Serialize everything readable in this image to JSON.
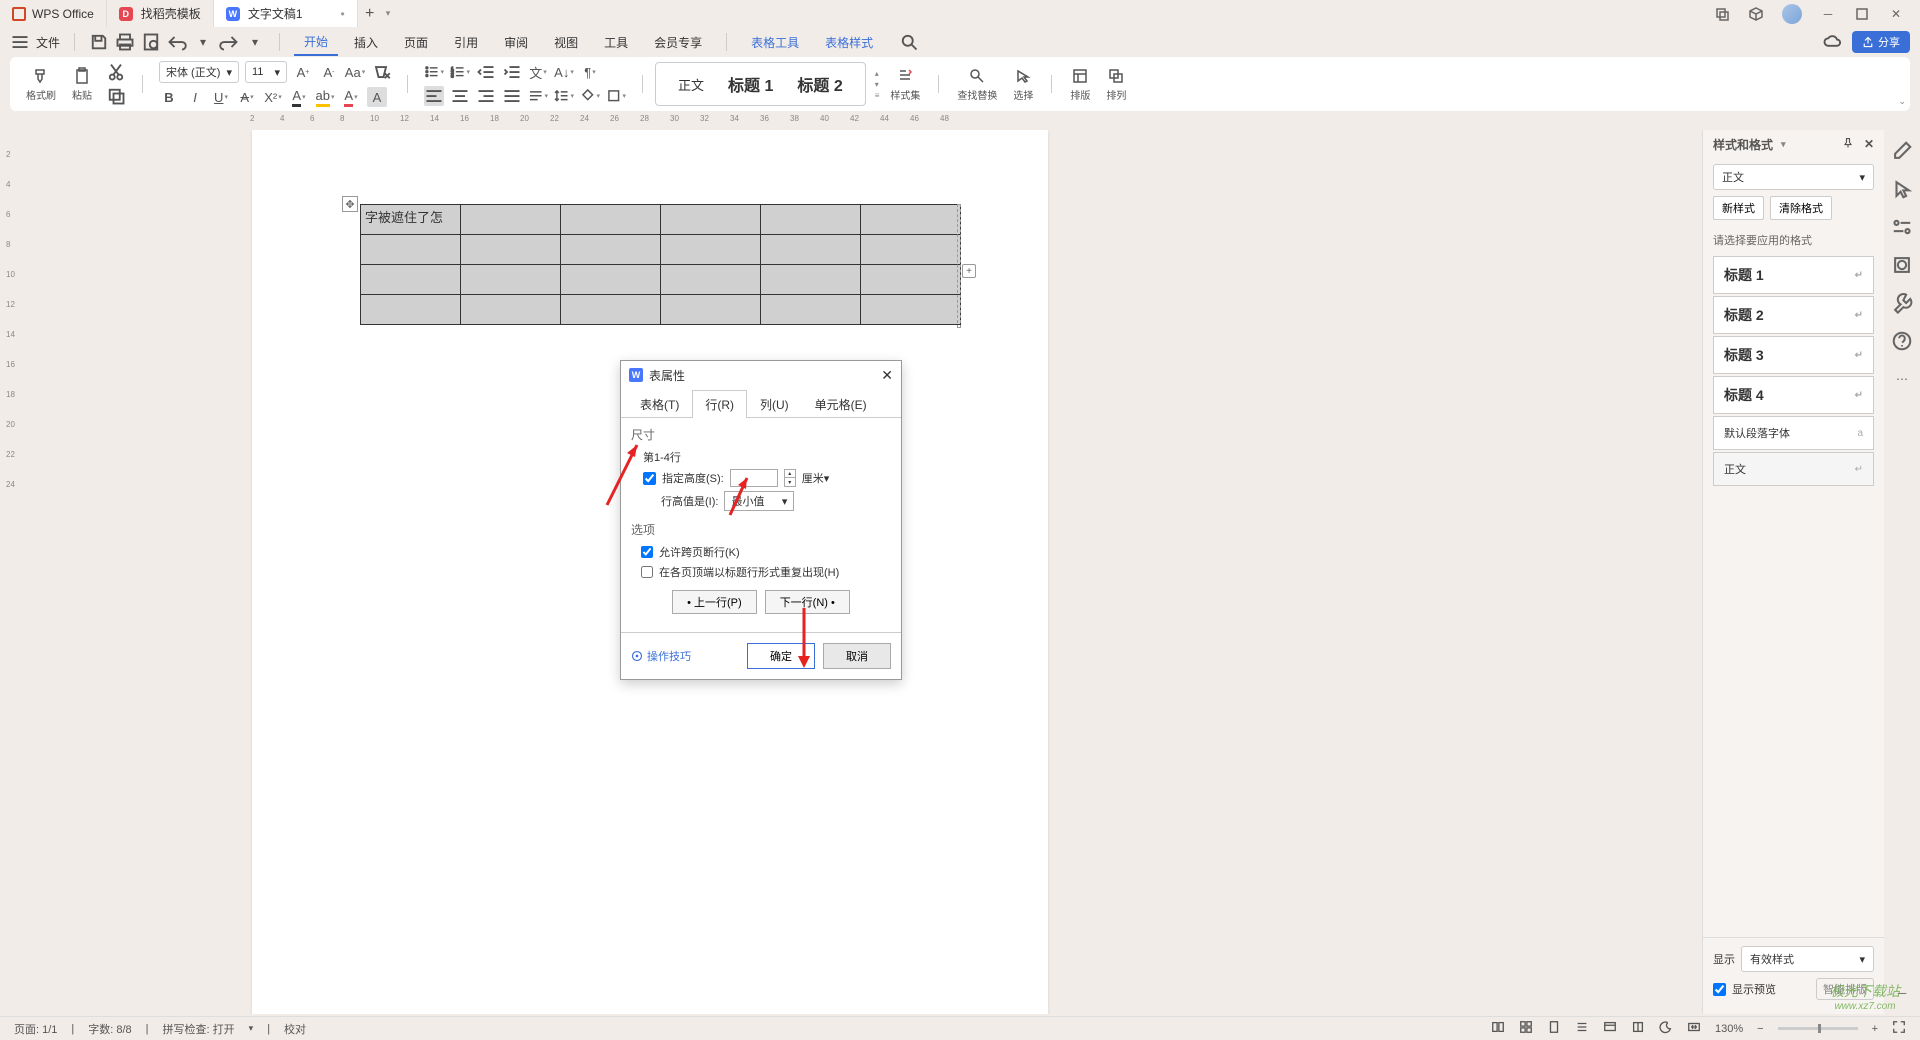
{
  "app": {
    "name": "WPS Office"
  },
  "tabs": [
    {
      "icon": "red",
      "iconLetter": "D",
      "label": "找稻壳模板"
    },
    {
      "icon": "blue",
      "iconLetter": "W",
      "label": "文字文稿1",
      "dirty": "•",
      "active": true
    }
  ],
  "menubar": {
    "fileLabel": "文件",
    "items": [
      "开始",
      "插入",
      "页面",
      "引用",
      "审阅",
      "视图",
      "工具",
      "会员专享"
    ],
    "activeIndex": 0,
    "extra": [
      "表格工具",
      "表格样式"
    ]
  },
  "share": "分享",
  "ribbon": {
    "formatBrush": "格式刷",
    "paste": "粘贴",
    "fontName": "宋体 (正文)",
    "fontSize": "11",
    "styleBody": "正文",
    "styleH1": "标题 1",
    "styleH2": "标题 2",
    "styleSet": "样式集",
    "findReplace": "查找替换",
    "select": "选择",
    "layout": "排版",
    "arrange": "排列"
  },
  "document": {
    "tableCellText": "字被遮住了怎"
  },
  "dialog": {
    "title": "表属性",
    "tabs": [
      "表格(T)",
      "行(R)",
      "列(U)",
      "单元格(E)"
    ],
    "activeTab": 1,
    "sizeLabel": "尺寸",
    "rowRange": "第1-4行",
    "specifyHeight": "指定高度(S):",
    "specifyHeightChecked": true,
    "unit": "厘米",
    "rowHeightIs": "行高值是(I):",
    "rowHeightValue": "最小值",
    "optionsLabel": "选项",
    "allowBreakChecked": true,
    "allowBreak": "允许跨页断行(K)",
    "repeatHeaderChecked": false,
    "repeatHeader": "在各页顶端以标题行形式重复出现(H)",
    "prevRow": "• 上一行(P)",
    "nextRow": "下一行(N) •",
    "tip": "操作技巧",
    "ok": "确定",
    "cancel": "取消"
  },
  "stylePanel": {
    "title": "样式和格式",
    "currentStyle": "正文",
    "newStyle": "新样式",
    "clearFormat": "清除格式",
    "selectHint": "请选择要应用的格式",
    "headings": [
      "标题 1",
      "标题 2",
      "标题 3",
      "标题 4"
    ],
    "defaultParaFont": "默认段落字体",
    "bodyStyle": "正文",
    "showLabel": "显示",
    "showValue": "有效样式",
    "showPreview": "显示预览",
    "smartLayout": "智能排版"
  },
  "statusbar": {
    "page": "页面: 1/1",
    "words": "字数: 8/8",
    "spellcheck": "拼写检查: 打开",
    "proof": "校对",
    "zoom": "130%"
  },
  "watermark": {
    "main": "极光下载站",
    "sub": "www.xz7.com"
  },
  "ruler": {
    "hTicks": [
      2,
      4,
      6,
      8,
      10,
      12,
      14,
      16,
      18,
      20,
      22,
      24,
      26,
      28,
      30,
      32,
      34,
      36,
      38,
      40,
      42,
      44,
      46,
      48
    ],
    "vTicks": [
      2,
      4,
      6,
      8,
      10,
      12,
      14,
      16,
      18,
      20,
      22,
      24
    ]
  }
}
